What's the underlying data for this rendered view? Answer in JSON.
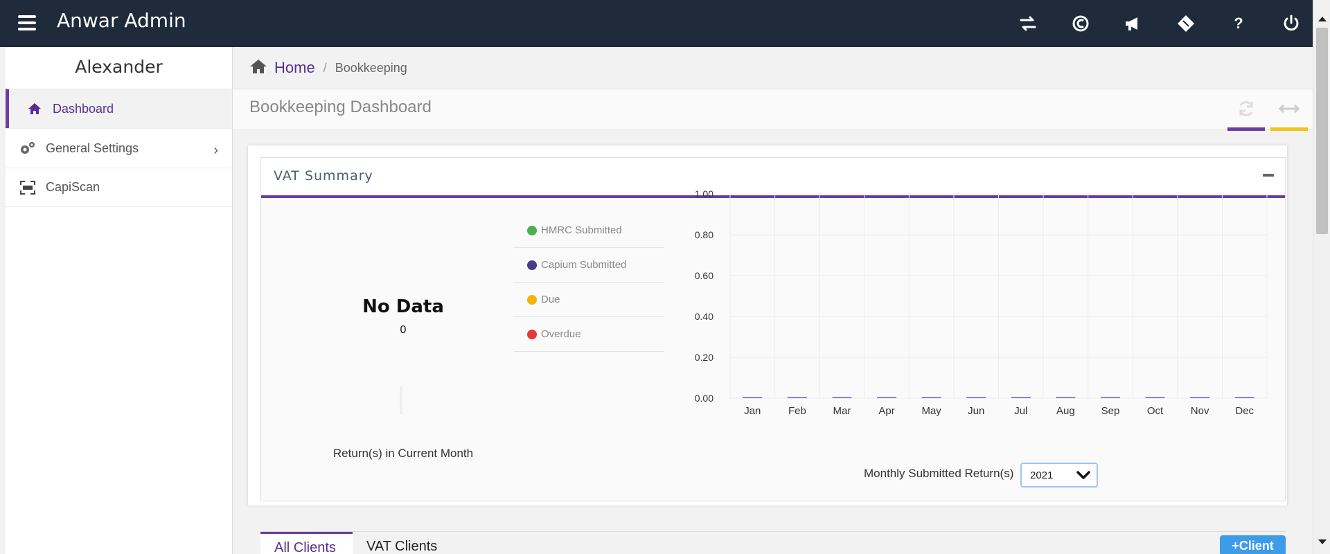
{
  "header": {
    "title": "Anwar Admin",
    "icons": [
      "switch-icon",
      "capium-icon",
      "megaphone-icon",
      "ticket-icon",
      "help-icon",
      "power-icon"
    ],
    "help_glyph": "?"
  },
  "sidebar": {
    "user": "Alexander",
    "items": [
      {
        "label": "Dashboard",
        "icon": "home-icon",
        "active": true
      },
      {
        "label": "General Settings",
        "icon": "gears-icon",
        "has_submenu": true
      },
      {
        "label": "CapiScan",
        "icon": "scan-icon"
      }
    ]
  },
  "breadcrumb": {
    "home": "Home",
    "sep": "/",
    "current": "Bookkeeping"
  },
  "page": {
    "title": "Bookkeeping Dashboard"
  },
  "vat_summary": {
    "title": "VAT Summary",
    "no_data": "No Data",
    "count": "0",
    "returns_label": "Return(s) in Current Month",
    "legend": [
      {
        "label": "HMRC Submitted",
        "color": "#4caf50"
      },
      {
        "label": "Capium Submitted",
        "color": "#4a3a8c"
      },
      {
        "label": "Due",
        "color": "#f5b301"
      },
      {
        "label": "Overdue",
        "color": "#e53935"
      }
    ],
    "monthly_label": "Monthly Submitted Return(s)",
    "year": "2021"
  },
  "chart_data": {
    "type": "bar",
    "categories": [
      "Jan",
      "Feb",
      "Mar",
      "Apr",
      "May",
      "Jun",
      "Jul",
      "Aug",
      "Sep",
      "Oct",
      "Nov",
      "Dec"
    ],
    "values": [
      0,
      0,
      0,
      0,
      0,
      0,
      0,
      0,
      0,
      0,
      0,
      0
    ],
    "yticks": [
      "0.00",
      "0.20",
      "0.40",
      "0.60",
      "0.80",
      "1.00"
    ],
    "ylim": [
      0,
      1
    ],
    "grid": true,
    "bar_color": "#6a5acd"
  },
  "tabs": {
    "all": "All Clients",
    "vat": "VAT Clients",
    "client_button": "Client",
    "client_plus": "+"
  },
  "colors": {
    "accent": "#6a3ea1",
    "topbar": "#1f2a3a",
    "warning": "#f0c419",
    "primary_button": "#3d9be9"
  }
}
